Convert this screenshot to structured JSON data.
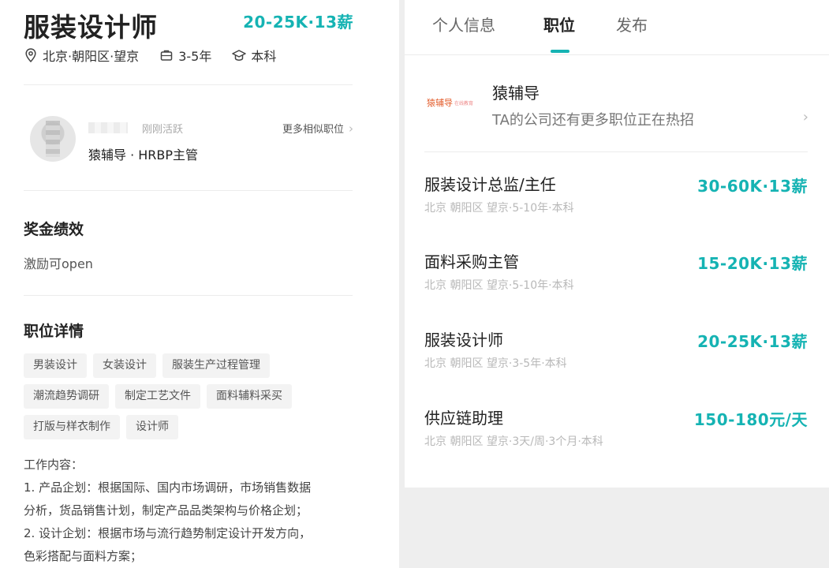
{
  "left": {
    "job_title": "服装设计师",
    "salary": "20-25K·13薪",
    "location": "北京·朝阳区·望京",
    "experience": "3-5年",
    "education": "本科",
    "recruiter": {
      "status": "刚刚活跃",
      "company_role": "猿辅导 · HRBP主管",
      "more_link": "更多相似职位"
    },
    "bonus_section": {
      "title": "奖金绩效",
      "text": "激励可open"
    },
    "details_section": {
      "title": "职位详情",
      "tags": [
        "男装设计",
        "女装设计",
        "服装生产过程管理",
        "潮流趋势调研",
        "制定工艺文件",
        "面料辅料采买",
        "打版与样衣制作",
        "设计师"
      ]
    },
    "description": {
      "heading": "工作内容：",
      "line1": "1. 产品企划：根据国际、国内市场调研，市场销售数据",
      "line2": "分析，货品销售计划，制定产品品类架构与价格企划；",
      "line3": "2. 设计企划：根据市场与流行趋势制定设计开发方向，",
      "line4": "色彩搭配与面料方案；"
    }
  },
  "right": {
    "tabs": [
      {
        "label": "个人信息"
      },
      {
        "label": "职位"
      },
      {
        "label": "发布"
      }
    ],
    "company": {
      "logo_text": "猿辅导",
      "logo_sub": "在线教育",
      "name": "猿辅导",
      "description": "TA的公司还有更多职位正在热招"
    },
    "jobs": [
      {
        "name": "服装设计总监/主任",
        "salary": "30-60K·13薪",
        "meta": "北京 朝阳区 望京·5-10年·本科"
      },
      {
        "name": "面料采购主管",
        "salary": "15-20K·13薪",
        "meta": "北京 朝阳区 望京·5-10年·本科"
      },
      {
        "name": "服装设计师",
        "salary": "20-25K·13薪",
        "meta": "北京 朝阳区 望京·3-5年·本科"
      },
      {
        "name": "供应链助理",
        "salary": "150-180元/天",
        "meta": "北京 朝阳区 望京·3天/周·3个月·本科"
      }
    ]
  },
  "colors": {
    "accent": "#15b3b3",
    "text": "#222222",
    "muted": "#b8b8b8"
  }
}
